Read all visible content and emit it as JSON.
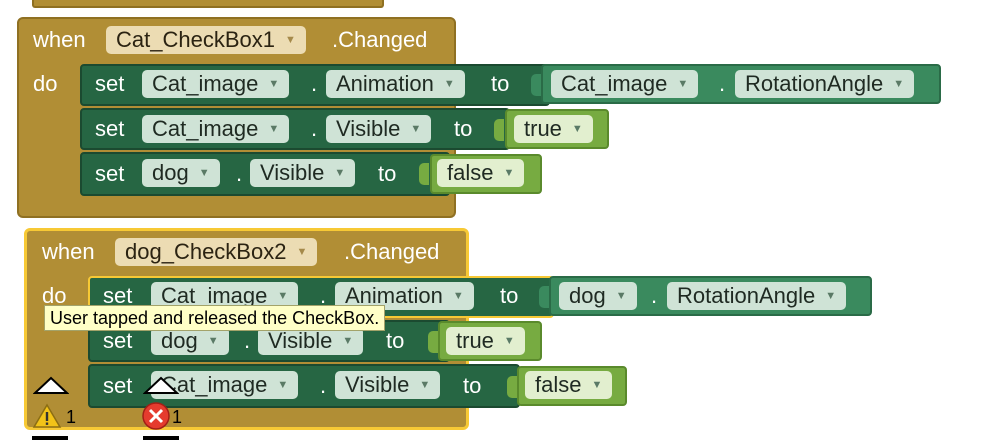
{
  "workspace": {
    "block1": {
      "when": "when",
      "component": "Cat_CheckBox1",
      "event": ".Changed",
      "do": "do",
      "statements": [
        {
          "set": "set",
          "component": "Cat_image",
          "dot": ".",
          "property": "Animation",
          "to": "to",
          "value": {
            "kind": "getter",
            "component": "Cat_image",
            "dot": ".",
            "property": "RotationAngle"
          }
        },
        {
          "set": "set",
          "component": "Cat_image",
          "dot": ".",
          "property": "Visible",
          "to": "to",
          "value": {
            "kind": "boolean",
            "text": "true"
          }
        },
        {
          "set": "set",
          "component": "dog",
          "dot": ".",
          "property": "Visible",
          "to": "to",
          "value": {
            "kind": "boolean",
            "text": "false"
          }
        }
      ]
    },
    "block2": {
      "when": "when",
      "component": "dog_CheckBox2",
      "event": ".Changed",
      "do": "do",
      "statements": [
        {
          "set": "set",
          "component": "Cat_image",
          "dot": ".",
          "property": "Animation",
          "to": "to",
          "value": {
            "kind": "getter",
            "component": "dog",
            "dot": ".",
            "property": "RotationAngle"
          }
        },
        {
          "set": "set",
          "component": "dog",
          "dot": ".",
          "property": "Visible",
          "to": "to",
          "value": {
            "kind": "boolean",
            "text": "true"
          }
        },
        {
          "set": "set",
          "component": "Cat_image",
          "dot": ".",
          "property": "Visible",
          "to": "to",
          "value": {
            "kind": "boolean",
            "text": "false"
          }
        }
      ]
    },
    "tooltip": "User tapped and released the CheckBox.",
    "indicators": {
      "warnings": "1",
      "errors": "1"
    }
  },
  "colors": {
    "event_block": "#b18e35",
    "setter_block": "#266643",
    "getter_block": "#3a8a5e",
    "boolean_block": "#77ab41",
    "selected_outline": "#f7c935",
    "tooltip_bg": "#ffffc7",
    "warning": "#f2c318",
    "error": "#e53b2e"
  },
  "icons": {
    "warning": "warning-triangle-icon",
    "error": "error-circle-icon",
    "collapse": "collapse-arrow-icon",
    "dropdown": "dropdown-arrow-icon"
  }
}
